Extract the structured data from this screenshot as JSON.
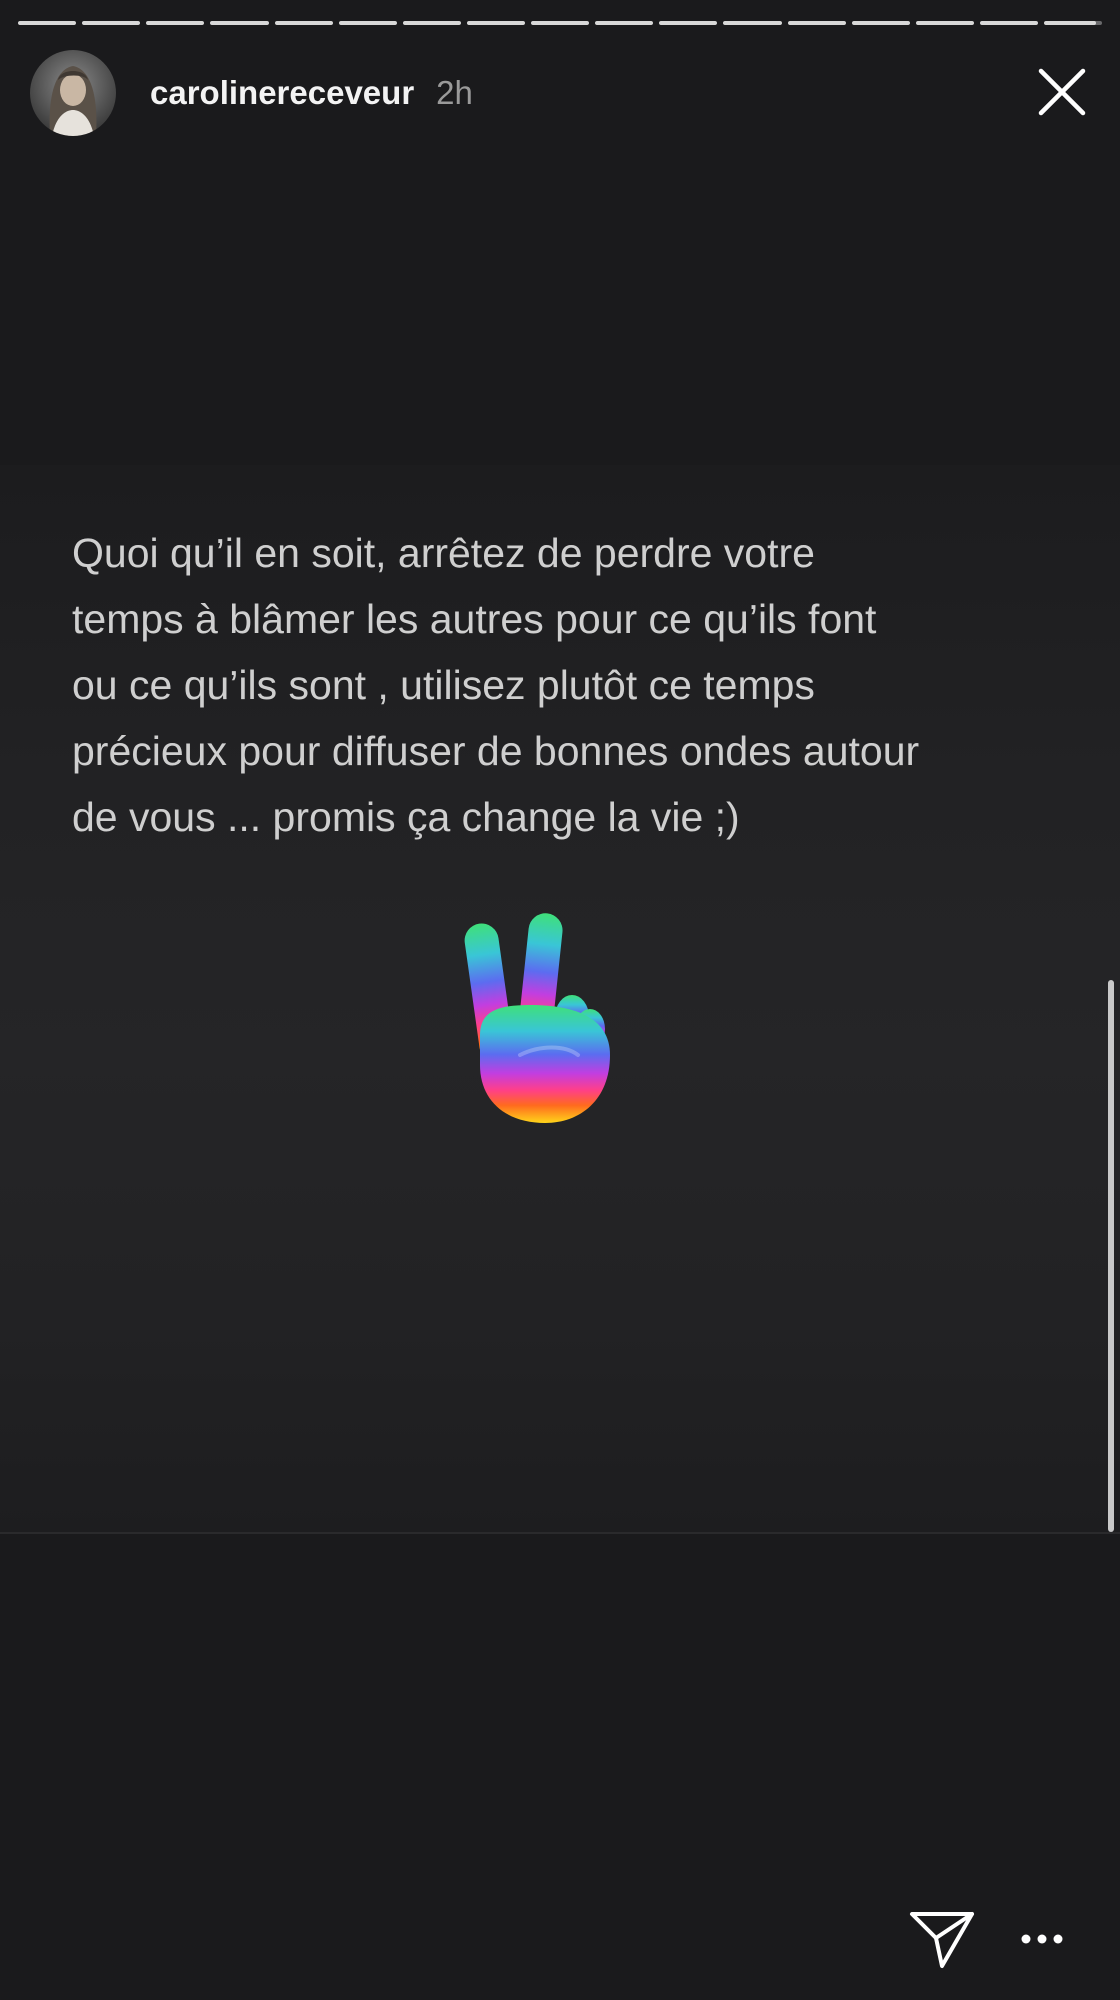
{
  "story": {
    "segments_total": 17,
    "segments_completed": 16,
    "current_segment_progress": 0.9,
    "author": {
      "username": "carolinereceveur",
      "posted_ago": "2h",
      "avatar_icon": "avatar-photo"
    },
    "text": "Quoi qu’il en soit, arrêtez de perdre votre\ntemps à blâmer les autres pour ce qu’ils font\nou ce qu’ils sont , utilisez plutôt ce temps\nprécieux pour diffuser de bonnes ondes autour\nde vous ...  promis ça change la vie ;)",
    "sticker_icon": "rainbow-peace-hand-icon"
  },
  "controls": {
    "close_icon": "close-icon",
    "share_icon": "send-icon",
    "more_icon": "more-options-icon"
  },
  "colors": {
    "background": "#1a1a1c",
    "progress_fill": "#d8d8d8",
    "text": "#cfcfcf",
    "timestamp": "#9a9a9a"
  }
}
